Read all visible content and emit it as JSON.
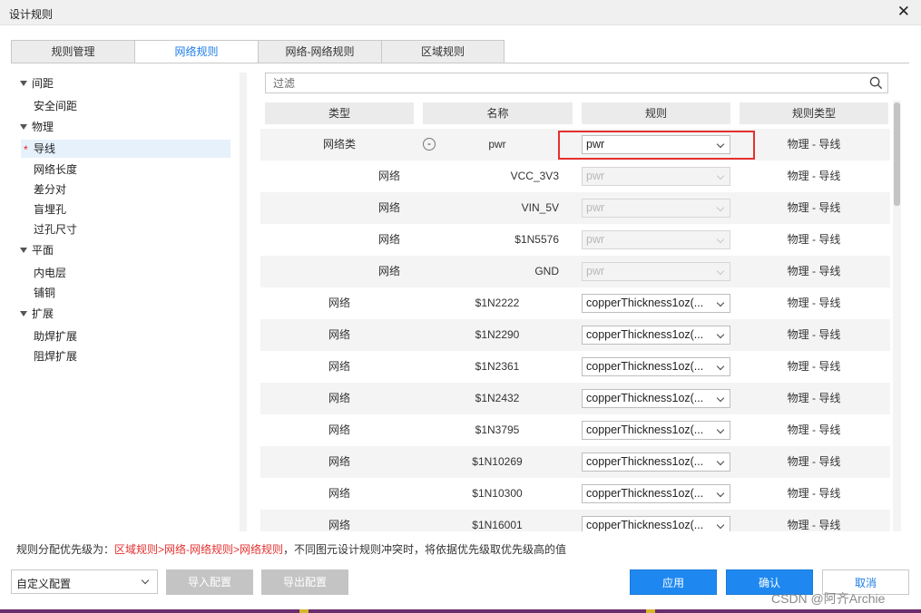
{
  "window": {
    "title": "设计规则",
    "close_icon": "close-icon"
  },
  "tabs": [
    {
      "label": "规则管理",
      "active": false
    },
    {
      "label": "网络规则",
      "active": true
    },
    {
      "label": "网络-网络规则",
      "active": false
    },
    {
      "label": "区域规则",
      "active": false
    }
  ],
  "tree": [
    {
      "label": "间距",
      "expanded": true
    },
    {
      "label": "安全间距"
    },
    {
      "label": "物理",
      "expanded": true
    },
    {
      "label": "导线",
      "selected": true,
      "marker": "*"
    },
    {
      "label": "网络长度"
    },
    {
      "label": "差分对"
    },
    {
      "label": "盲埋孔"
    },
    {
      "label": "过孔尺寸"
    },
    {
      "label": "平面",
      "expanded": true
    },
    {
      "label": "内电层"
    },
    {
      "label": "铺铜"
    },
    {
      "label": "扩展",
      "expanded": true
    },
    {
      "label": "助焊扩展"
    },
    {
      "label": "阻焊扩展"
    }
  ],
  "filter": {
    "placeholder": "过滤",
    "icon": "search-icon"
  },
  "columns": [
    "类型",
    "名称",
    "规则",
    "规则类型"
  ],
  "rows": [
    {
      "type": "网络类",
      "name": "pwr",
      "rule": "pwr",
      "rule_type": "物理 - 导线",
      "level": 0,
      "collapse": "-",
      "highlight": true,
      "disabled": false
    },
    {
      "type": "网络",
      "name": "VCC_3V3",
      "rule": "pwr",
      "rule_type": "物理 - 导线",
      "level": 1,
      "disabled": true
    },
    {
      "type": "网络",
      "name": "VIN_5V",
      "rule": "pwr",
      "rule_type": "物理 - 导线",
      "level": 1,
      "disabled": true
    },
    {
      "type": "网络",
      "name": "$1N5576",
      "rule": "pwr",
      "rule_type": "物理 - 导线",
      "level": 1,
      "disabled": true
    },
    {
      "type": "网络",
      "name": "GND",
      "rule": "pwr",
      "rule_type": "物理 - 导线",
      "level": 1,
      "disabled": true
    },
    {
      "type": "网络",
      "name": "$1N2222",
      "rule": "copperThickness1oz(...",
      "rule_type": "物理 - 导线",
      "level": 0,
      "disabled": false
    },
    {
      "type": "网络",
      "name": "$1N2290",
      "rule": "copperThickness1oz(...",
      "rule_type": "物理 - 导线",
      "level": 0,
      "disabled": false
    },
    {
      "type": "网络",
      "name": "$1N2361",
      "rule": "copperThickness1oz(...",
      "rule_type": "物理 - 导线",
      "level": 0,
      "disabled": false
    },
    {
      "type": "网络",
      "name": "$1N2432",
      "rule": "copperThickness1oz(...",
      "rule_type": "物理 - 导线",
      "level": 0,
      "disabled": false
    },
    {
      "type": "网络",
      "name": "$1N3795",
      "rule": "copperThickness1oz(...",
      "rule_type": "物理 - 导线",
      "level": 0,
      "disabled": false
    },
    {
      "type": "网络",
      "name": "$1N10269",
      "rule": "copperThickness1oz(...",
      "rule_type": "物理 - 导线",
      "level": 0,
      "disabled": false
    },
    {
      "type": "网络",
      "name": "$1N10300",
      "rule": "copperThickness1oz(...",
      "rule_type": "物理 - 导线",
      "level": 0,
      "disabled": false
    },
    {
      "type": "网络",
      "name": "$1N16001",
      "rule": "copperThickness1oz(...",
      "rule_type": "物理 - 导线",
      "level": 0,
      "disabled": false
    }
  ],
  "footer": {
    "priority_prefix": "规则分配优先级为：",
    "priority_order": "区域规则>网络-网络规则>网络规则",
    "priority_suffix": "，不同图元设计规则冲突时，将依据优先级取优先级高的值",
    "preset_value": "自定义配置",
    "import_label": "导入配置",
    "export_label": "导出配置",
    "apply_label": "应用",
    "ok_label": "确认",
    "cancel_label": "取消"
  },
  "watermark": "CSDN @阿齐Archie",
  "colors": {
    "accent": "#1e88f0",
    "highlight": "#e53030",
    "selected_bg": "#e6f1fb"
  }
}
